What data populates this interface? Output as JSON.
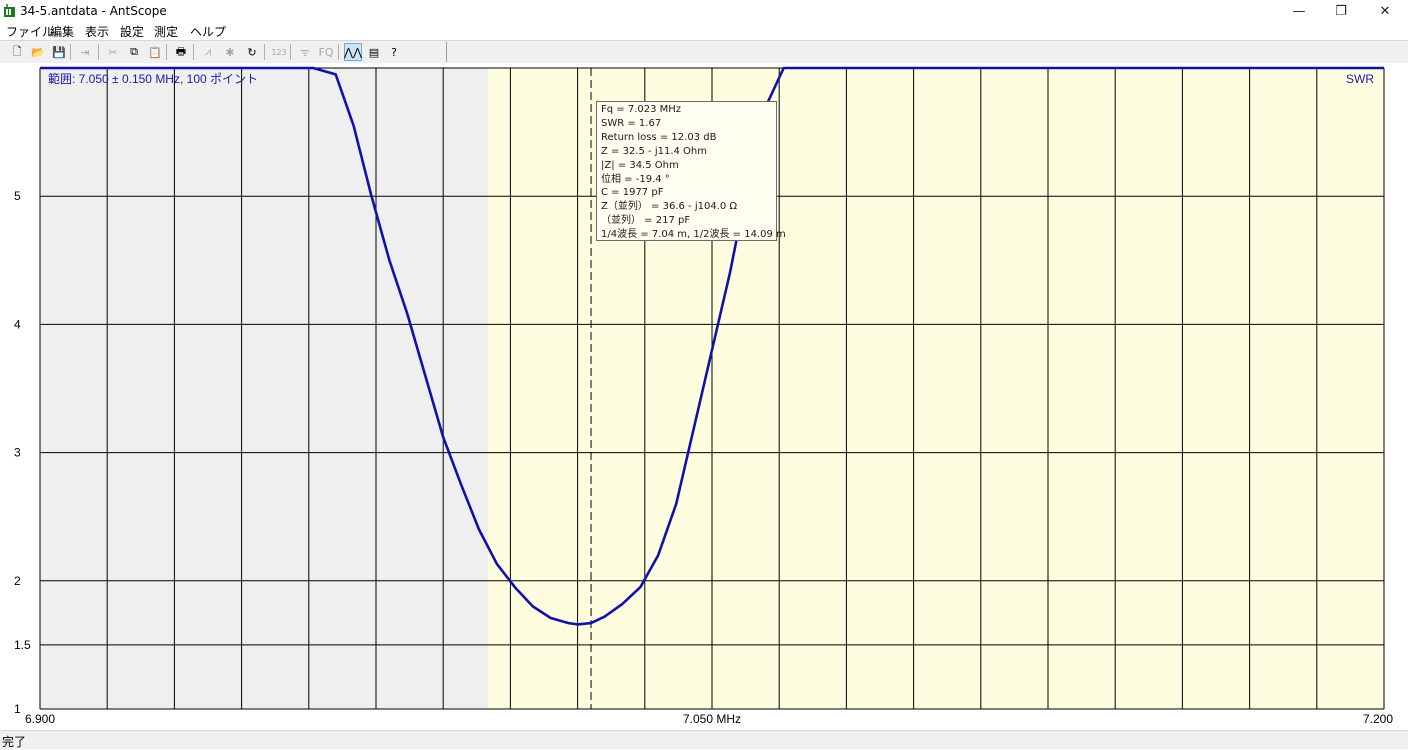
{
  "window": {
    "title": "34-5.antdata - AntScope",
    "minimize_glyph": "—",
    "maximize_glyph": "❐",
    "close_glyph": "✕"
  },
  "menu": [
    "ファイル",
    "編集",
    "表示",
    "設定",
    "測定",
    "ヘルプ"
  ],
  "toolbar": {
    "buttons": [
      {
        "icon": "new-file-icon",
        "glyph": "🗋",
        "state": "normal"
      },
      {
        "icon": "open-folder-icon",
        "glyph": "📂",
        "state": "normal"
      },
      {
        "icon": "save-icon",
        "glyph": "💾",
        "state": "normal"
      },
      {
        "icon": "export-icon",
        "glyph": "⇥",
        "state": "disabled"
      },
      {
        "icon": "cut-icon",
        "glyph": "✂",
        "state": "disabled"
      },
      {
        "icon": "copy-icon",
        "glyph": "⧉",
        "state": "normal"
      },
      {
        "icon": "paste-icon",
        "glyph": "📋",
        "state": "disabled"
      },
      {
        "icon": "print-icon",
        "glyph": "🖶",
        "state": "normal"
      },
      {
        "icon": "sweep-icon",
        "glyph": "⩘",
        "state": "disabled"
      },
      {
        "icon": "star-icon",
        "glyph": "✱",
        "state": "disabled"
      },
      {
        "icon": "refresh-icon",
        "glyph": "↻",
        "state": "normal"
      },
      {
        "icon": "numbers-icon",
        "glyph": "123",
        "state": "disabled"
      },
      {
        "icon": "antenna-icon",
        "glyph": "ᯤ",
        "state": "disabled"
      },
      {
        "icon": "fq-icon",
        "glyph": "FQ",
        "state": "disabled"
      },
      {
        "icon": "swr-graph-icon",
        "glyph": "⋀⋀",
        "state": "active"
      },
      {
        "icon": "chart-icon",
        "glyph": "▤",
        "state": "normal"
      },
      {
        "icon": "help-icon",
        "glyph": "?",
        "state": "normal"
      }
    ]
  },
  "chart_data": {
    "type": "line",
    "range_label": "範囲: 7.050 ± 0.150 MHz, 100 ポイント",
    "series_label": "SWR",
    "x_tick_labels": [
      "6.900",
      "7.050 MHz",
      "7.200"
    ],
    "y_tick_labels": [
      "1",
      "1.5",
      "2",
      "3",
      "4",
      "5"
    ],
    "y_ticks": [
      1,
      1.5,
      2,
      3,
      4,
      5
    ],
    "xlim": [
      6.9,
      7.2
    ],
    "ylim": [
      1,
      6
    ],
    "band_highlight": [
      7.0,
      7.2
    ],
    "cursor_mhz": 7.023,
    "series": [
      {
        "name": "SWR",
        "color": "#1111aa",
        "x": [
          6.9,
          6.961,
          6.966,
          6.97,
          6.974,
          6.978,
          6.982,
          6.986,
          6.99,
          6.994,
          6.998,
          7.002,
          7.006,
          7.01,
          7.014,
          7.018,
          7.02,
          7.023,
          7.026,
          7.03,
          7.034,
          7.038,
          7.042,
          7.046,
          7.05,
          7.054,
          7.058,
          7.062,
          7.066,
          7.07,
          7.2
        ],
        "values": [
          6.0,
          6.0,
          5.95,
          5.55,
          5.0,
          4.5,
          4.08,
          3.6,
          3.12,
          2.75,
          2.4,
          2.13,
          1.95,
          1.8,
          1.71,
          1.67,
          1.66,
          1.67,
          1.72,
          1.82,
          1.95,
          2.2,
          2.6,
          3.2,
          3.8,
          4.4,
          5.1,
          5.7,
          6.0,
          6.0,
          6.0
        ]
      }
    ],
    "grid": true,
    "legend": "top-right"
  },
  "info": {
    "lines": [
      "Fq = 7.023 MHz",
      "SWR = 1.67",
      "Return loss = 12.03 dB",
      "Z = 32.5 - j11.4 Ohm",
      "|Z| = 34.5 Ohm",
      "位相 = -19.4 °",
      "C = 1977 pF",
      "Z（並列） = 36.6 - j104.0 Ω",
      "（並列） = 217 pF",
      "1/4波長 = 7.04 m, 1/2波長 = 14.09 m"
    ]
  },
  "status": {
    "text": "完了"
  }
}
